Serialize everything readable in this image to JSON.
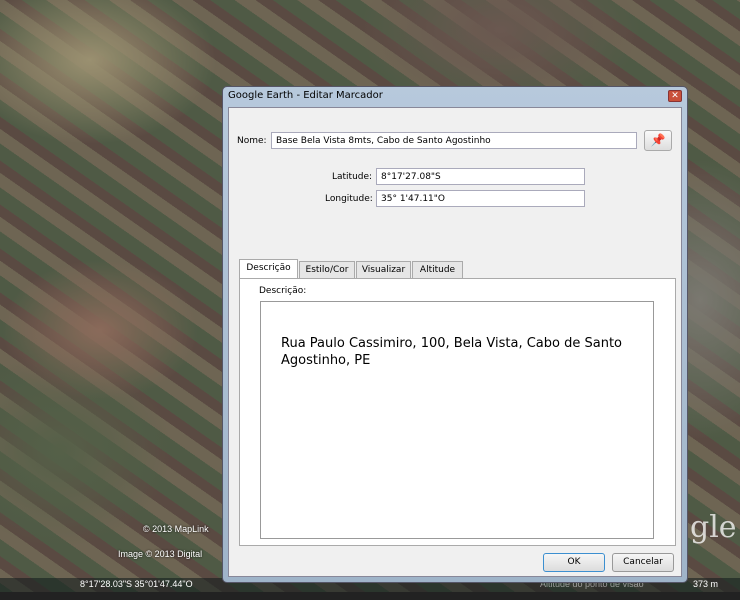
{
  "map": {
    "copyright1": "© 2013 MapLink",
    "copyright2": "Image © 2013 Digital",
    "logo": "gle",
    "status_coords": "8°17'28.03\"S   35°01'47.44\"O",
    "status_altitude": "Altitude do ponto de visão",
    "status_alt_value": "373 m"
  },
  "dialog": {
    "title": "Google Earth - Editar Marcador",
    "close_icon": "close-icon",
    "name_label": "Nome:",
    "name_value": "Base Bela Vista 8mts, Cabo de Santo Agostinho",
    "lat_label": "Latitude:",
    "lat_value": "8°17'27.08\"S",
    "lon_label": "Longitude:",
    "lon_value": "35° 1'47.11\"O",
    "tabs": [
      {
        "label": "Descrição"
      },
      {
        "label": "Estilo/Cor"
      },
      {
        "label": "Visualizar"
      },
      {
        "label": "Altitude"
      }
    ],
    "desc_label": "Descrição:",
    "desc_value": "Rua Paulo Cassimiro, 100, Bela Vista, Cabo de Santo Agostinho, PE",
    "ok": "OK",
    "cancel": "Cancelar",
    "pin_icon": "pushpin-icon"
  }
}
